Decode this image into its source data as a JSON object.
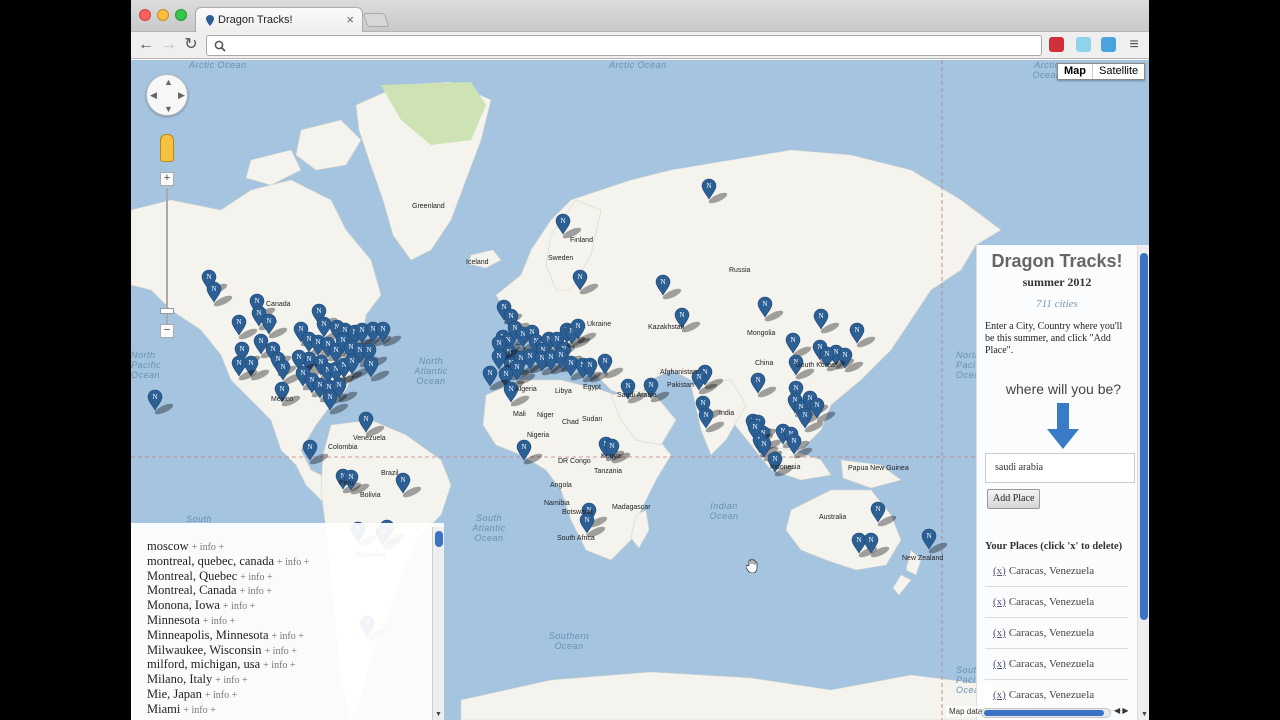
{
  "browser": {
    "tab_title": "Dragon Tracks!",
    "tab_close": "×",
    "address": "",
    "back": "←",
    "forward": "→",
    "reload": "↻",
    "menu": "≡"
  },
  "map": {
    "type_buttons": [
      "Map",
      "Satellite"
    ],
    "zoom_in": "+",
    "zoom_out": "−",
    "zoom_level_fraction": 0.05,
    "ocean_labels": [
      "Arctic Ocean",
      "Arctic Ocean",
      "Arctic Ocean",
      "North Atlantic Ocean",
      "South Atlantic Ocean",
      "Indian Ocean",
      "Southern Ocean",
      "North Pacific Ocean",
      "North Pacific Ocean",
      "South",
      "South Pacific Ocean"
    ],
    "place_labels": [
      "Greenland",
      "Iceland",
      "Finland",
      "Sweden",
      "Russia",
      "Canada",
      "Kazakhstan",
      "Mongolia",
      "China",
      "Ukraine",
      "Algeria",
      "Libya",
      "Egypt",
      "Saudi Arabia",
      "Afghanistan",
      "Pakistan",
      "Mali",
      "Niger",
      "Chad",
      "Sudan",
      "Nigeria",
      "DR Congo",
      "Kenya",
      "Tanzania",
      "Angola",
      "Namibia",
      "Botswana",
      "South Africa",
      "Madagascar",
      "Mexico",
      "Venezuela",
      "Colombia",
      "Peru",
      "Brazil",
      "Bolivia",
      "Argentina",
      "India",
      "Indonesia",
      "South Korea",
      "Papua New Guinea",
      "Australia",
      "New Zealand"
    ],
    "map_data_text": "Map data",
    "marker_color": "#2c5f94"
  },
  "city_list": {
    "items": [
      {
        "name": "moscow",
        "extra": "+ info +"
      },
      {
        "name": "montreal, quebec, canada",
        "extra": "+ info +"
      },
      {
        "name": "Montreal, Quebec",
        "extra": "+ info +"
      },
      {
        "name": "Montreal, Canada",
        "extra": "+ info +"
      },
      {
        "name": "Monona, Iowa",
        "extra": "+ info +"
      },
      {
        "name": "Minnesota",
        "extra": "+ info +"
      },
      {
        "name": "Minneapolis, Minnesota",
        "extra": "+ info +"
      },
      {
        "name": "Milwaukee, Wisconsin",
        "extra": "+ info +"
      },
      {
        "name": "milford, michigan, usa",
        "extra": "+ info +"
      },
      {
        "name": "Milano, Italy",
        "extra": "+ info +"
      },
      {
        "name": "Mie, Japan",
        "extra": "+ info +"
      },
      {
        "name": "Miami",
        "extra": "+ info +"
      }
    ]
  },
  "panel": {
    "title": "Dragon Tracks!",
    "subtitle": "summer 2012",
    "count": "711 cities",
    "instructions": "Enter a City, Country where you'll be this summer, and click \"Add Place\".",
    "prompt": "where will you be?",
    "input_value": "saudi arabia",
    "add_button": "Add Place",
    "places_heading": "Your Places (click 'x' to delete)",
    "delete_label": "(x)",
    "places": [
      "Caracas, Venezuela",
      "Caracas, Venezuela",
      "Caracas, Venezuela",
      "Caracas, Venezuela",
      "Caracas, Venezuela"
    ],
    "arrow_color": "#3a7bc8"
  }
}
